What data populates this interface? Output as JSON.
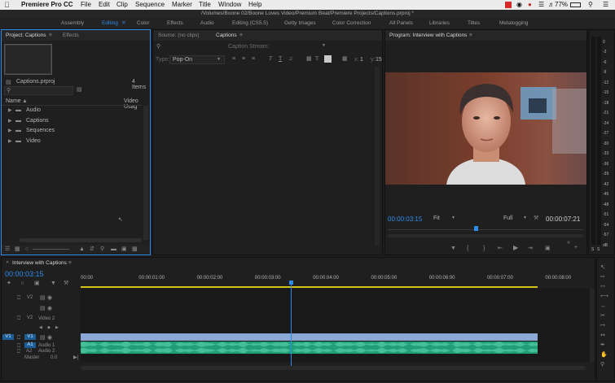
{
  "menubar": {
    "apple": "",
    "app": "Premiere Pro CC",
    "items": [
      "File",
      "Edit",
      "Clip",
      "Sequence",
      "Marker",
      "Title",
      "Window",
      "Help"
    ],
    "battery": "77%"
  },
  "titlebar": {
    "path": "/Volumes/Boone 02/Boone Loves Video/Premium Beat/Premiere Projects/Captions.prproj *"
  },
  "workspaces": [
    "Assembly",
    "Editing",
    "Color",
    "Effects",
    "Audio",
    "Editing (CS5.5)",
    "Getty Images",
    "Color Correction",
    "All Panels",
    "Libraries",
    "Titles",
    "Metalogging"
  ],
  "workspace_active": "Editing",
  "project": {
    "tab_project": "Project: Captions",
    "tab_effects": "Effects",
    "filename": "Captions.prproj",
    "count": "4 Items",
    "col_name": "Name",
    "col_usage": "Video Usag",
    "bins": [
      "Audio",
      "Captions",
      "Sequences",
      "Video"
    ]
  },
  "source": {
    "tab_source": "Source: (no clips)",
    "tab_captions": "Captions",
    "stream_label": "Caption Stream:",
    "type_label": "Type:",
    "type_value": "Pop-On",
    "x_label": "x:",
    "x_value": "1",
    "y_label": "y:",
    "y_value": "15"
  },
  "program": {
    "tab": "Program: Interview with Captions",
    "timecode": "00:00:03:15",
    "fit": "Fit",
    "quality": "Full",
    "duration": "00:00:07:21",
    "playhead_position": 0.45
  },
  "meter_scale": [
    "0",
    "-6",
    "-12",
    "-18",
    "-24",
    "-30",
    "-36",
    "-42",
    "-48",
    "-54",
    "dB"
  ],
  "meter_scale_top": [
    "-3",
    "-9",
    "-15",
    "-21",
    "-27",
    "-33",
    "-39",
    "-45",
    "-51",
    "-57"
  ],
  "meter_solo": [
    "S",
    "S"
  ],
  "timeline": {
    "tab": "Interview with Captions",
    "timecode": "00:00:03:15",
    "ruler": [
      "00:00",
      "00:00:01:00",
      "00:00:02:00",
      "00:00:03:00",
      "00:00:04:00",
      "00:00:05:00",
      "00:00:06:00",
      "00:00:07:00",
      "00:00:08:00"
    ],
    "tracks": {
      "v2": "V2",
      "v2b": "V2",
      "video2": "Video 2",
      "v1_src": "V1",
      "v1": "V1",
      "a1_src": "A1",
      "audio1": "Audio 1",
      "a2": "A2",
      "audio2": "Audio 2",
      "master": "Master",
      "master_val": "0.0"
    },
    "playhead_time": 3.625,
    "clip_end_time": 7.875
  },
  "colors": {
    "accent": "#2d8ceb",
    "video_clip": "#8aa7d6",
    "audio_clip": "#1f9e78",
    "work_area": "#d6c31a"
  }
}
